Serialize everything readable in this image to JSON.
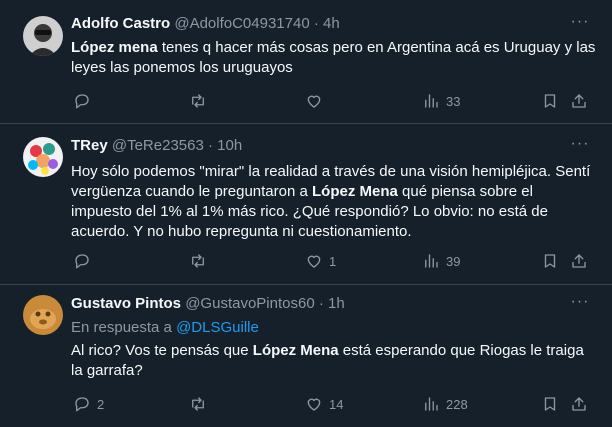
{
  "tweets": [
    {
      "name": "Adolfo Castro",
      "handle": "@AdolfoC04931740",
      "separator": "·",
      "time": "4h",
      "reply_to": null,
      "text_pre": "",
      "mention_bold": "López mena",
      "text_post": " tenes q hacer más cosas pero en Argentina acá es Uruguay y las leyes las ponemos los uruguayos",
      "replies": "",
      "retweets": "",
      "likes": "",
      "views": "33"
    },
    {
      "name": "TRey",
      "handle": "@TeRe23563",
      "separator": "·",
      "time": "10h",
      "reply_to": null,
      "text_pre": "Hoy sólo podemos \"mirar\" la realidad a través de una visión hemipléjica. Sentí vergüenza cuando le preguntaron a ",
      "mention_bold": "López Mena",
      "text_post": " qué piensa sobre el impuesto del 1% al 1% más rico. ¿Qué respondió? Lo obvio: no está de acuerdo. Y no hubo repregunta ni cuestionamiento.",
      "replies": "",
      "retweets": "",
      "likes": "1",
      "views": "39"
    },
    {
      "name": "Gustavo Pintos",
      "handle": "@GustavoPintos60",
      "separator": "·",
      "time": "1h",
      "reply_to_label": "En respuesta a",
      "reply_to": "@DLSGuille",
      "text_pre": "Al rico? Vos te pensás que ",
      "mention_bold": "López Mena",
      "text_post": " está esperando que Riogas le traiga la garrafa?",
      "replies": "2",
      "retweets": "",
      "likes": "14",
      "views": "228"
    }
  ],
  "more_glyph": "···"
}
